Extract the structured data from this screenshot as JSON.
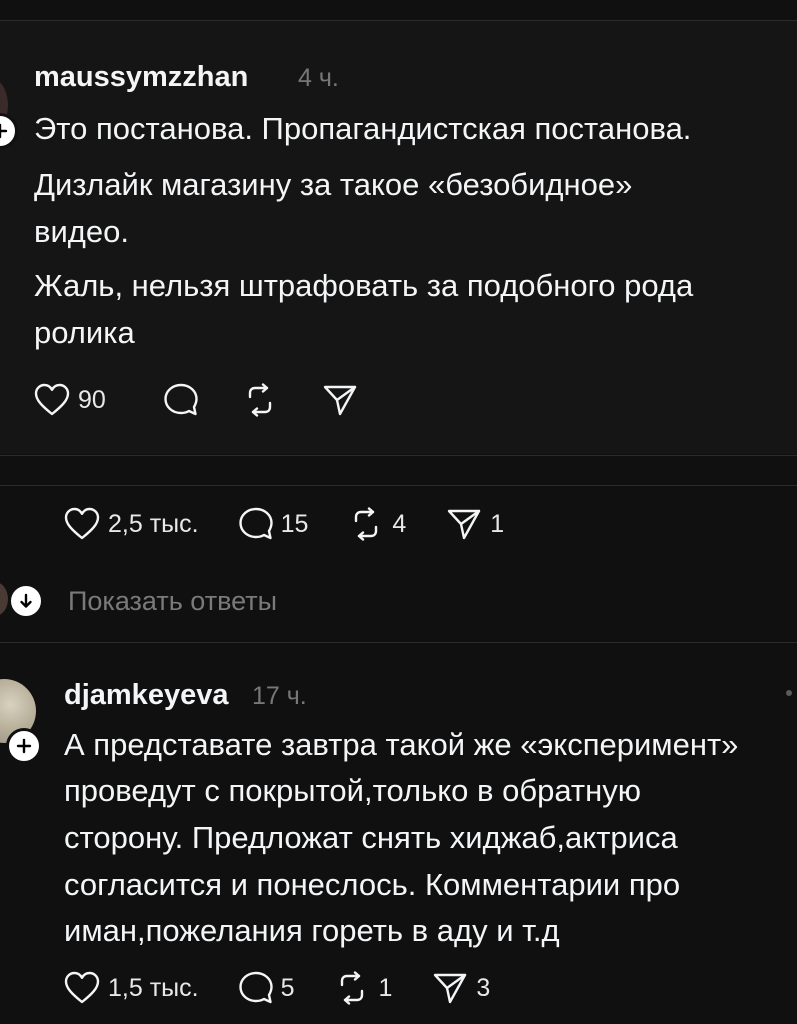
{
  "comment1": {
    "username": "maussymzzhan",
    "time": "4 ч.",
    "lines": [
      "Это постанова. Пропагандистская постанова.",
      "Дизлайк магазину за такое «безобидное»",
      "видео.",
      "Жаль, нельзя штрафовать за подобного рода",
      "ролика"
    ],
    "likes": "90"
  },
  "post_stats": {
    "likes": "2,5 тыс.",
    "replies": "15",
    "reposts": "4",
    "shares": "1"
  },
  "show_replies": {
    "label": "Показать ответы"
  },
  "comment2": {
    "username": "djamkeyeva",
    "time": "17 ч.",
    "lines": [
      "А представате завтра такой же «эксперимент»",
      "проведут с покрытой,только в обратную",
      "сторону. Предложат снять хиджаб,актриса",
      "согласится и понеслось. Комментарии про",
      "иман,пожелания гореть в аду и т.д"
    ],
    "likes": "1,5 тыс.",
    "replies": "5",
    "reposts": "1",
    "shares": "3"
  }
}
